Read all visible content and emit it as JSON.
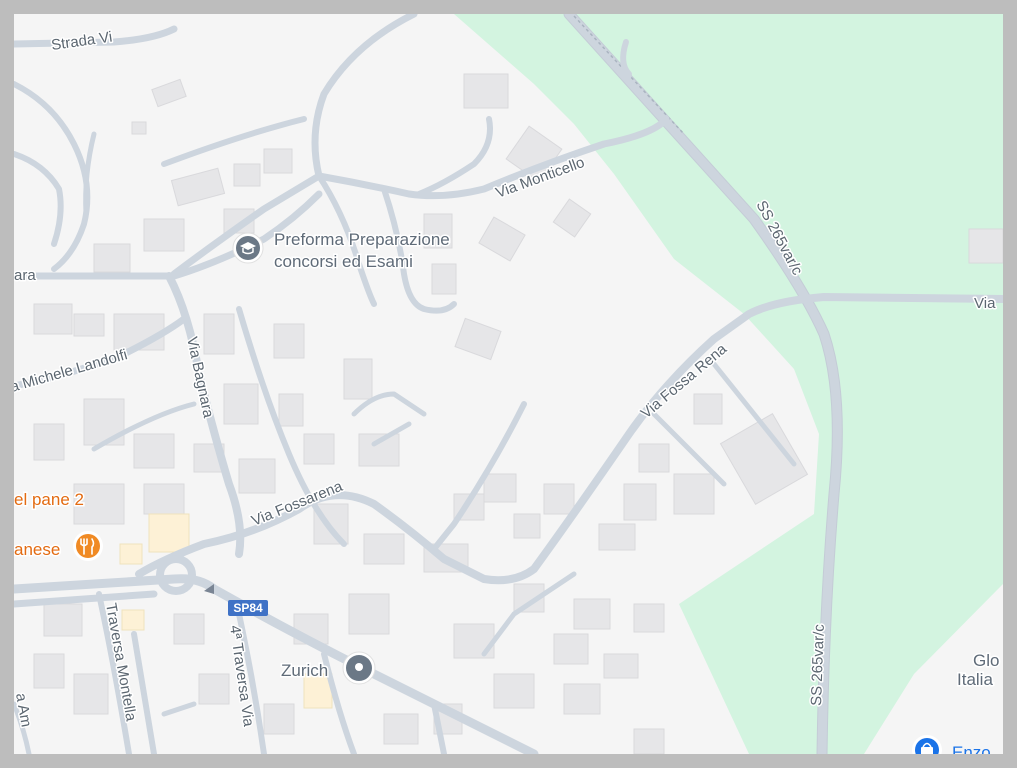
{
  "map": {
    "roads": {
      "strada_top": "Strada Vi",
      "monticello": "Via Monticello",
      "bara": "ara",
      "michele_landolfi": "a Michele Landolfi",
      "bagnara": "Via Bagnara",
      "fossarena": "Via Fossarena",
      "fossa_rena": "Via Fossa Rena",
      "ss_upper": "SS 265var/c",
      "ss_lower": "SS 265var/c",
      "via_right": "Via",
      "traversa_montella": "Traversa Montella",
      "traversa_via": "4ª Traversa Via",
      "am": "a Am",
      "shield_sp84": "SP84"
    },
    "pois": {
      "preforma_line1": "Preforma Preparazione",
      "preforma_line2": "concorsi ed Esami",
      "pane": "el pane 2",
      "anese": "anese",
      "zurich": "Zurich",
      "glo": "Glo",
      "italia": "Italia",
      "enzo": "Enzo"
    },
    "colors": {
      "background": "#f5f5f5",
      "park": "#d3f4e0",
      "road": "#cdd5de",
      "building": "#e6e6e8",
      "food_poi": "#e36b12",
      "education_poi": "#5f6b78",
      "shopping_poi": "#1a73e8",
      "route_shield": "#3f72c6"
    },
    "icons": {
      "preforma": "graduation-cap-icon",
      "restaurant": "fork-knife-icon",
      "zurich": "location-pin-icon",
      "shopping": "shopping-bag-icon"
    }
  }
}
